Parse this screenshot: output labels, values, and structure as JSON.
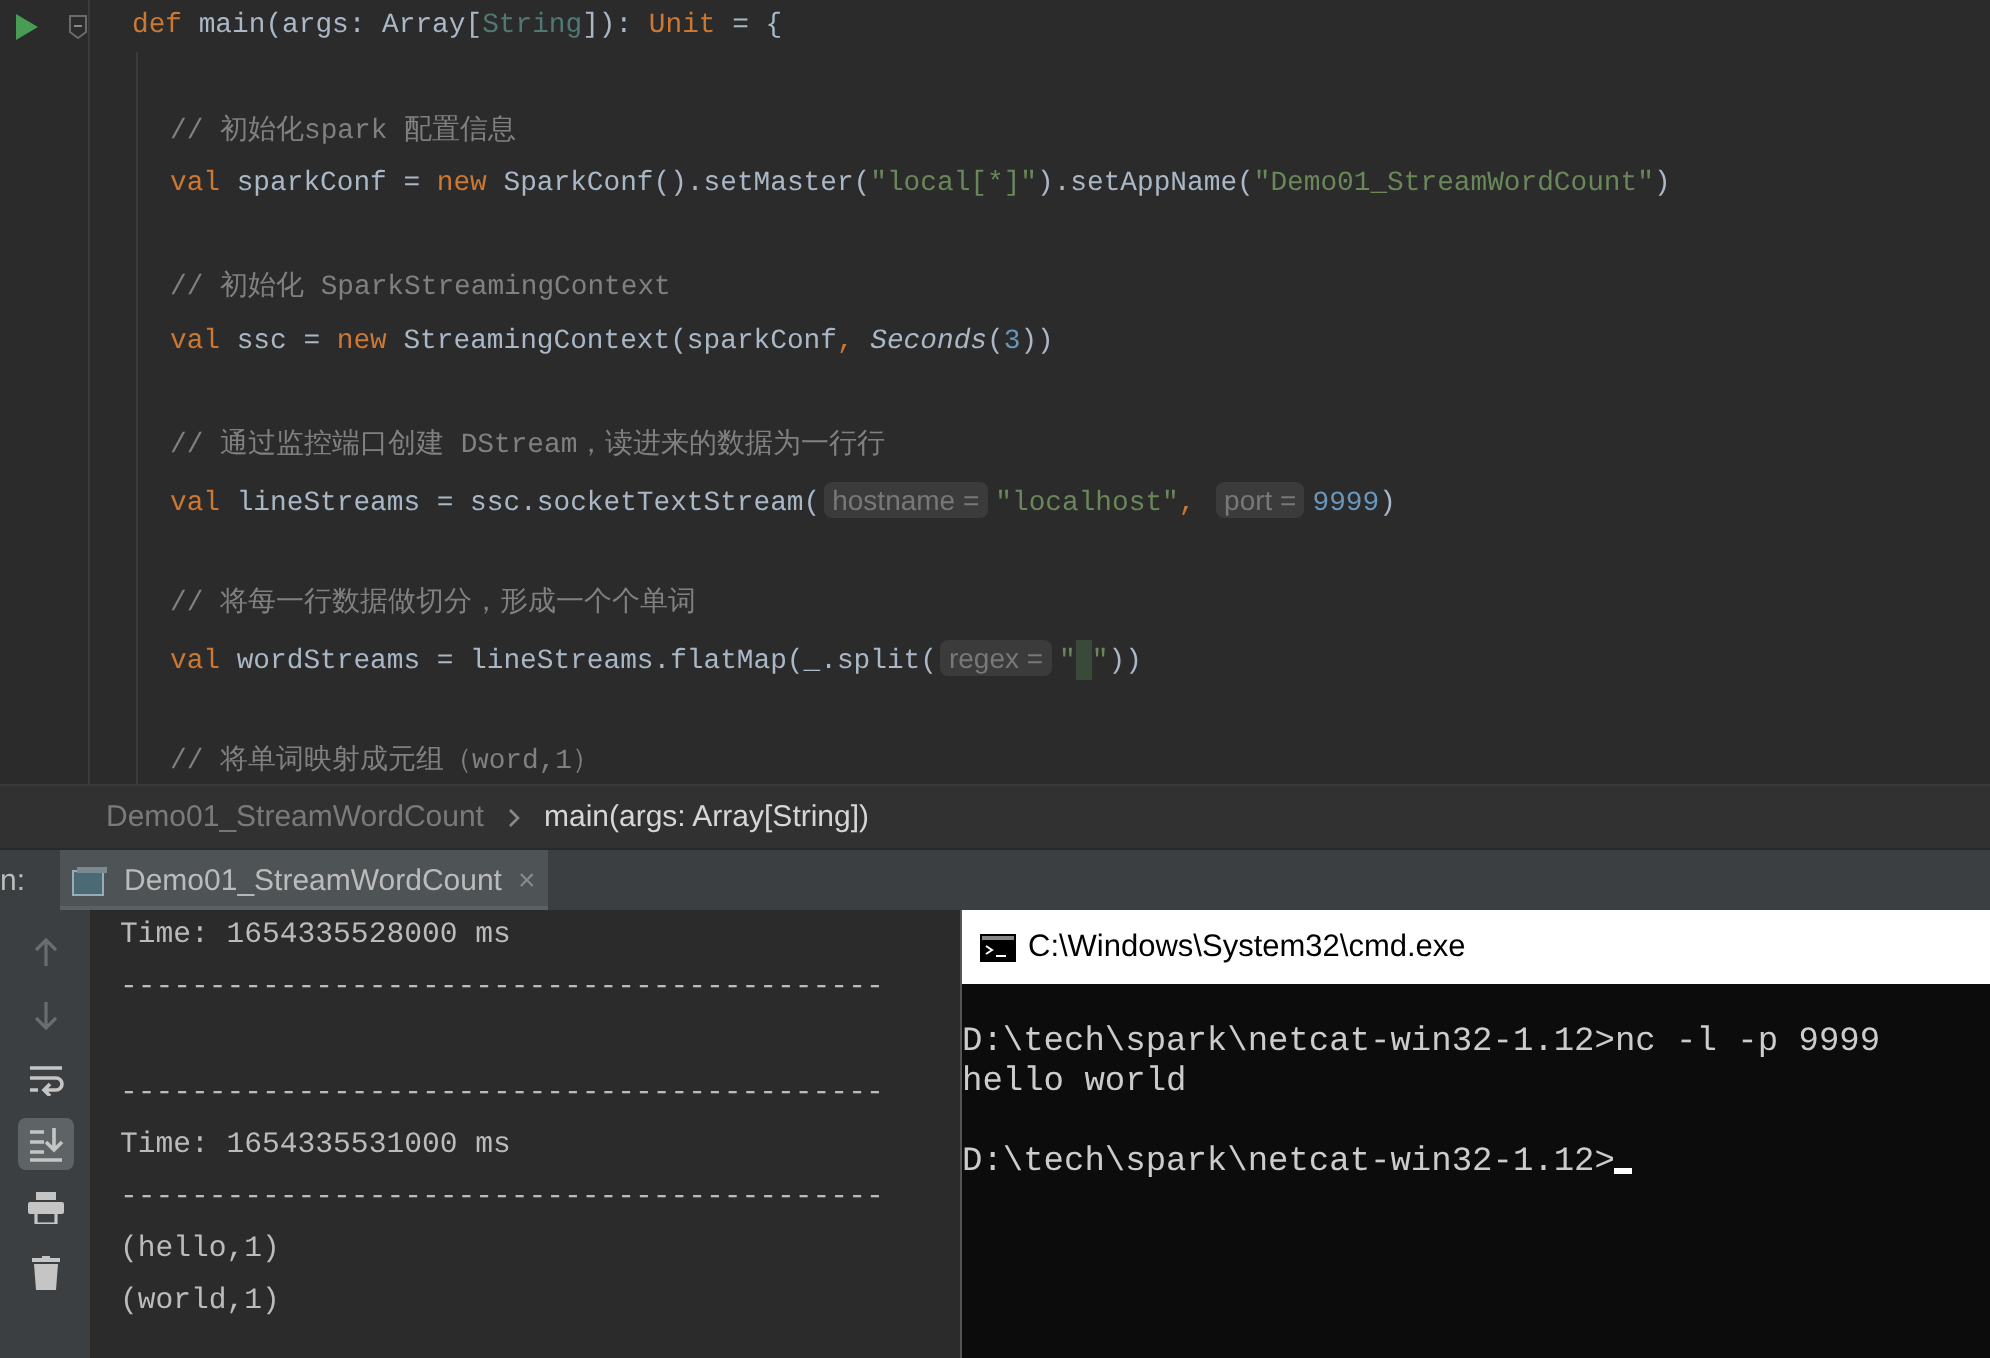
{
  "editor": {
    "signature": [
      {
        "kind": "kw",
        "text": "def"
      },
      {
        "kind": "plain",
        "text": " main(args: Array["
      },
      {
        "kind": "type",
        "text": "String"
      },
      {
        "kind": "plain",
        "text": "]): "
      },
      {
        "kind": "kw",
        "text": "Unit"
      },
      {
        "kind": "plain",
        "text": " = {"
      }
    ],
    "run_gutter_icon": true,
    "body": [
      {
        "comment": "// 初始化spark 配置信息",
        "code": [
          {
            "kind": "kw",
            "text": "val"
          },
          {
            "kind": "plain",
            "text": " sparkConf = "
          },
          {
            "kind": "kw",
            "text": "new"
          },
          {
            "kind": "plain",
            "text": " SparkConf().setMaster("
          },
          {
            "kind": "str",
            "text": "\"local[*]\""
          },
          {
            "kind": "plain",
            "text": ").setAppName("
          },
          {
            "kind": "str",
            "text": "\"Demo01_StreamWordCount\""
          },
          {
            "kind": "plain",
            "text": ")"
          }
        ]
      },
      {
        "comment": "// 初始化 SparkStreamingContext",
        "code": [
          {
            "kind": "kw",
            "text": "val"
          },
          {
            "kind": "plain",
            "text": " ssc = "
          },
          {
            "kind": "kw",
            "text": "new"
          },
          {
            "kind": "plain",
            "text": " StreamingContext(sparkConf"
          },
          {
            "kind": "kw",
            "text": ", "
          },
          {
            "kind": "italic",
            "text": "Seconds"
          },
          {
            "kind": "plain",
            "text": "("
          },
          {
            "kind": "num",
            "text": "3"
          },
          {
            "kind": "plain",
            "text": "))"
          }
        ]
      },
      {
        "comment": "// 通过监控端口创建 DStream，读进来的数据为一行行",
        "code": [
          {
            "kind": "kw",
            "text": "val"
          },
          {
            "kind": "plain",
            "text": " lineStreams = ssc.socketTextStream("
          },
          {
            "kind": "hint",
            "text": "hostname ="
          },
          {
            "kind": "str",
            "text": "\"localhost\""
          },
          {
            "kind": "kw",
            "text": ", "
          },
          {
            "kind": "hint",
            "text": "port ="
          },
          {
            "kind": "num",
            "text": "9999"
          },
          {
            "kind": "plain",
            "text": ")"
          }
        ]
      },
      {
        "comment": "// 将每一行数据做切分，形成一个个单词",
        "code": [
          {
            "kind": "kw",
            "text": "val"
          },
          {
            "kind": "plain",
            "text": " wordStreams = lineStreams.flatMap(_.split("
          },
          {
            "kind": "hint",
            "text": "regex ="
          },
          {
            "kind": "str",
            "text": "\""
          },
          {
            "kind": "caret"
          },
          {
            "kind": "str",
            "text": "\""
          },
          {
            "kind": "plain",
            "text": "))"
          }
        ]
      },
      {
        "comment": "// 将单词映射成元组（word,1）"
      }
    ]
  },
  "breadcrumbs": [
    {
      "label": "Demo01_StreamWordCount",
      "selected": false
    },
    {
      "label": "main(args: Array[String])",
      "selected": true
    }
  ],
  "run_panel": {
    "label": "n:",
    "tabs": [
      {
        "label": "Demo01_StreamWordCount",
        "selected": true,
        "close": "×"
      }
    ],
    "toolbar": [
      {
        "kind": "up",
        "disabled": true,
        "selected": false
      },
      {
        "kind": "down",
        "disabled": true,
        "selected": false
      },
      {
        "kind": "wrap",
        "disabled": false,
        "selected": false
      },
      {
        "kind": "scroll-end",
        "disabled": false,
        "selected": true
      },
      {
        "kind": "print",
        "disabled": false,
        "selected": false
      },
      {
        "kind": "trash",
        "disabled": false,
        "selected": false
      }
    ],
    "console": [
      {
        "kind": "text",
        "text": "Time: 1654335528000 ms"
      },
      {
        "kind": "text",
        "text": "-------------------------------------------"
      },
      {
        "kind": "gap"
      },
      {
        "kind": "text",
        "text": "-------------------------------------------"
      },
      {
        "kind": "text",
        "text": "Time: 1654335531000 ms"
      },
      {
        "kind": "text",
        "text": "-------------------------------------------"
      },
      {
        "kind": "text",
        "text": "(hello,1)"
      },
      {
        "kind": "text",
        "text": "(world,1)"
      }
    ]
  },
  "cmd_window": {
    "title": "C:\\Windows\\System32\\cmd.exe",
    "lines": [
      {
        "kind": "gap"
      },
      {
        "kind": "text",
        "text": "D:\\tech\\spark\\netcat-win32-1.12>nc -l -p 9999",
        "cursor": false
      },
      {
        "kind": "text",
        "text": "hello world",
        "cursor": false
      },
      {
        "kind": "gap"
      },
      {
        "kind": "text",
        "text": "D:\\tech\\spark\\netcat-win32-1.12>",
        "cursor": true
      }
    ]
  }
}
